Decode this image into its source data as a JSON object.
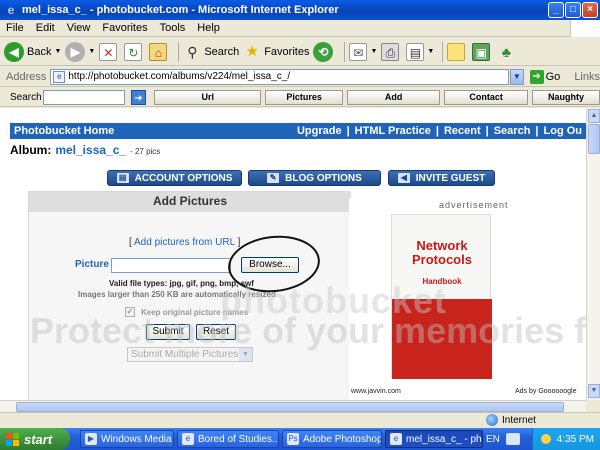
{
  "window": {
    "title": "mel_issa_c_ - photobucket.com - Microsoft Internet Explorer",
    "controls": [
      "_",
      "□",
      "×"
    ]
  },
  "menu": [
    "File",
    "Edit",
    "View",
    "Favorites",
    "Tools",
    "Help"
  ],
  "toolbar": {
    "back_label": "Back",
    "search_label": "Search",
    "favorites_label": "Favorites"
  },
  "address": {
    "label": "Address",
    "url": "http://photobucket.com/albums/v224/mel_issa_c_/",
    "go_label": "Go",
    "links_label": "Links"
  },
  "search_toolbar": {
    "label": "Search",
    "segments": [
      "Url",
      "Pictures",
      "Add",
      "Contact",
      "Naughty"
    ]
  },
  "site": {
    "header_title": "Photobucket Home",
    "header_links": [
      "Upgrade",
      "HTML Practice",
      "Recent",
      "Search",
      "Log Ou"
    ],
    "album_label": "Album:",
    "album_name": "mel_issa_c_",
    "pic_count": "- 27 pics",
    "option_buttons": [
      "ACCOUNT OPTIONS",
      "BLOG OPTIONS",
      "INVITE GUEST"
    ]
  },
  "upload": {
    "title": "Add Pictures",
    "add_from_url_prefix": "[",
    "add_from_url_link": "Add pictures from URL",
    "add_from_url_suffix": "]",
    "picture_label": "Picture",
    "browse_label": "Browse...",
    "valid_types": "Valid file types: jpg, gif, png, bmp, swf",
    "size_note": "Images larger than 250 KB are automatically resized",
    "keep_names_label": "Keep original picture names",
    "keep_names_checked": true,
    "submit_label": "Submit",
    "reset_label": "Reset",
    "multi_select": "Submit Multiple Pictures"
  },
  "ad": {
    "label": "advertisement",
    "book_title": "Network Protocols",
    "book_subtitle": "Handbook",
    "url": "www.javvin.com",
    "ads_by": "Ads by Goooooogle"
  },
  "watermark": {
    "line1": "photobucket",
    "line2": "Protect more of your memories for less!"
  },
  "status": {
    "zone": "Internet"
  },
  "taskbar": {
    "start_label": "start",
    "items": [
      "Windows Media ...",
      "Bored of Studies...",
      "Adobe Photoshop",
      "mel_issa_c_ - ph..."
    ],
    "active_index": 3,
    "language": "EN",
    "clock": "4:35 PM"
  }
}
